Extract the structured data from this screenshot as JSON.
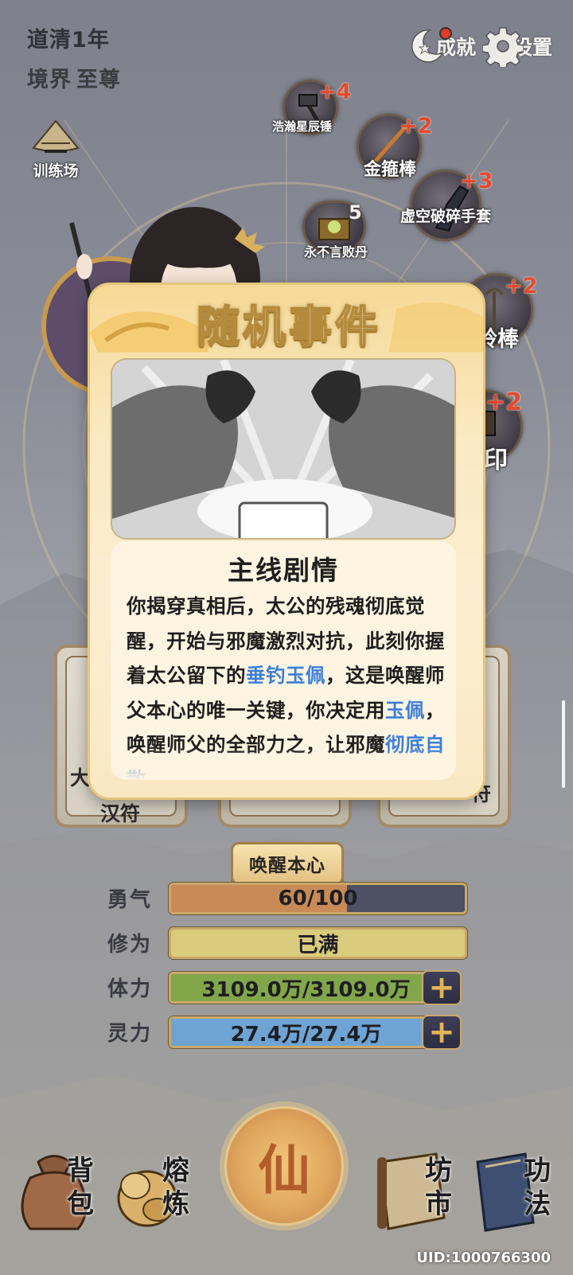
{
  "header": {
    "year": "道清1年",
    "realm_label": "境界",
    "realm_value": "至尊"
  },
  "top_buttons": {
    "achievement_label": "成就",
    "settings_label": "设置"
  },
  "training": {
    "label": "训练场"
  },
  "weapons": [
    {
      "name": "浩瀚星辰锤",
      "count": "+4"
    },
    {
      "name": "金箍棒",
      "count": "+2"
    },
    {
      "name": "虚空破碎手套",
      "count": "+3"
    },
    {
      "name": "永不言败丹",
      "count": "5"
    },
    {
      "name": "铃棒",
      "count": "+2"
    },
    {
      "name": "印",
      "count": "+2"
    }
  ],
  "cards": [
    {
      "text_top": "大",
      "text_bottom": "汉符"
    },
    {
      "text_top": "",
      "text_bottom": ""
    },
    {
      "text_top": "",
      "text_bottom": "符"
    }
  ],
  "modal": {
    "title": "随机事件",
    "event_title": "主线剧情",
    "body_parts": [
      {
        "text": "你揭穿真相后，太公的残魂彻底觉醒，开始与邪魔激烈对抗，此刻你握着太公留下的",
        "highlight": false
      },
      {
        "text": "垂钓玉佩",
        "highlight": true
      },
      {
        "text": "，这是唤醒师父本心的唯一关键，你决定用",
        "highlight": false
      },
      {
        "text": "玉佩",
        "highlight": true
      },
      {
        "text": "，唤醒师父的全部力之，让邪魔",
        "highlight": false
      },
      {
        "text": "彻底自散",
        "highlight": true
      }
    ]
  },
  "action_button": {
    "label": "唤醒本心"
  },
  "stats": [
    {
      "label": "勇气",
      "value": "60/100",
      "fill": 0.6,
      "color": "#c88a56",
      "has_plus": false
    },
    {
      "label": "修为",
      "value": "已满",
      "fill": 1.0,
      "color": "#d9cc7c",
      "has_plus": false
    },
    {
      "label": "体力",
      "value": "3109.0万/3109.0万",
      "fill": 1.0,
      "color": "#82a64a",
      "has_plus": true
    },
    {
      "label": "灵力",
      "value": "27.4万/27.4万",
      "fill": 1.0,
      "color": "#6ea4d4",
      "has_plus": true
    }
  ],
  "nav": {
    "bag": "背包",
    "smelt": "熔炼",
    "center": "仙",
    "market": "坊市",
    "skills": "功法"
  },
  "uid": "UID:1000766300"
}
